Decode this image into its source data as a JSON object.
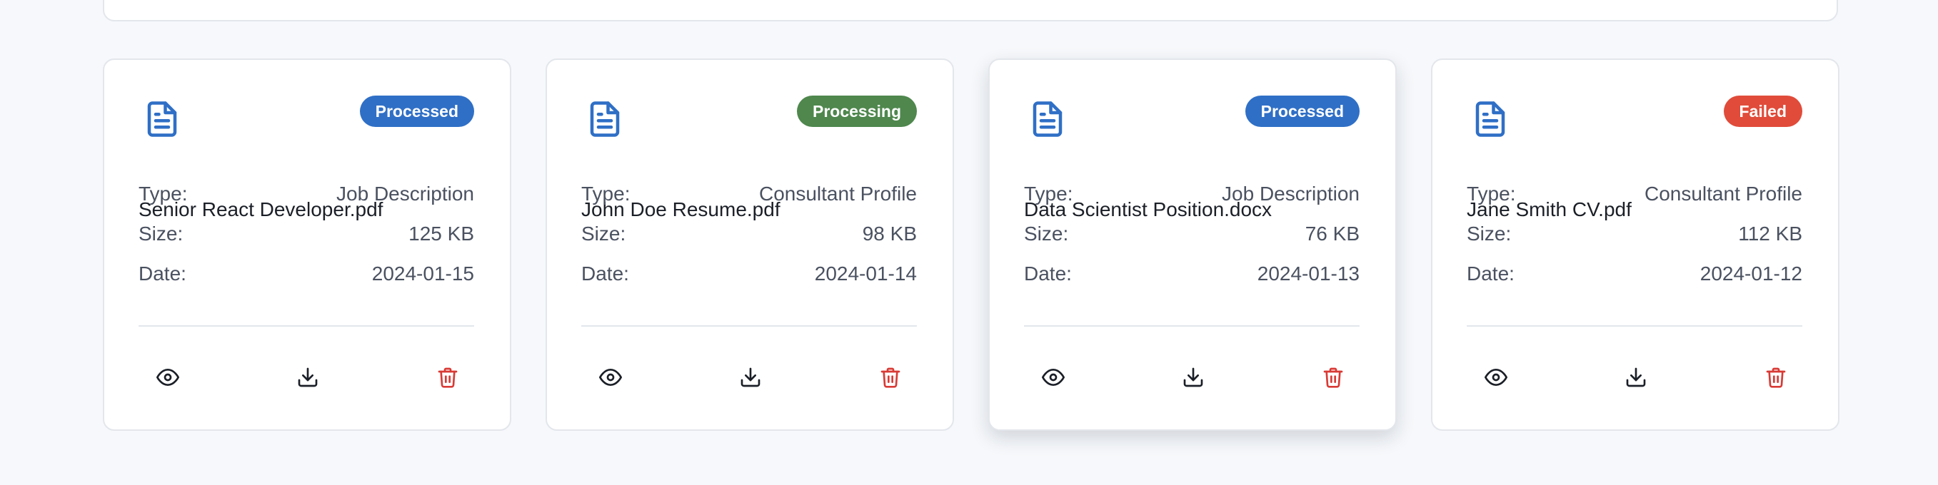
{
  "colors": {
    "accent": "#2f6fc6",
    "processed": "#2f6fc6",
    "processing": "#4f874d",
    "failed": "#e04b3a",
    "delete": "#d93a35",
    "icon": "#1b1f27"
  },
  "labels": {
    "type": "Type:",
    "size": "Size:",
    "date": "Date:"
  },
  "icons": {
    "file": "file-text-icon",
    "view": "eye-icon",
    "download": "download-icon",
    "delete": "trash-icon"
  },
  "documents": [
    {
      "name": "Senior React Developer.pdf",
      "status": "Processed",
      "status_color": "#2f6fc6",
      "type": "Job Description",
      "size": "125 KB",
      "date": "2024-01-15"
    },
    {
      "name": "John Doe Resume.pdf",
      "status": "Processing",
      "status_color": "#4f874d",
      "type": "Consultant Profile",
      "size": "98 KB",
      "date": "2024-01-14"
    },
    {
      "name": "Data Scientist Position.docx",
      "status": "Processed",
      "status_color": "#2f6fc6",
      "type": "Job Description",
      "size": "76 KB",
      "date": "2024-01-13"
    },
    {
      "name": "Jane Smith CV.pdf",
      "status": "Failed",
      "status_color": "#e04b3a",
      "type": "Consultant Profile",
      "size": "112 KB",
      "date": "2024-01-12"
    }
  ]
}
